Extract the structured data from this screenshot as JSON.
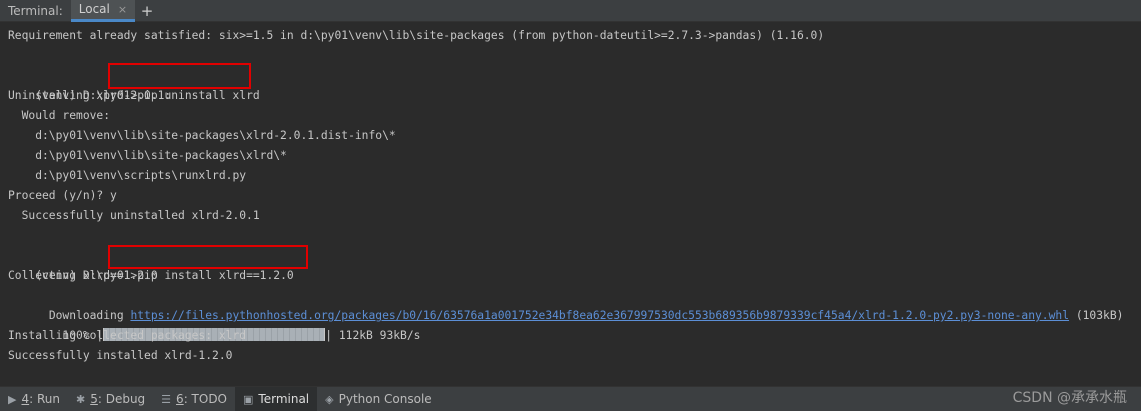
{
  "header": {
    "title": "Terminal:",
    "tab_label": "Local",
    "close_glyph": "×",
    "add_glyph": "+"
  },
  "terminal": {
    "line1": "Requirement already satisfied: six>=1.5 in d:\\py01\\venv\\lib\\site-packages (from python-dateutil>=2.7.3->pandas) (1.16.0)",
    "prompt": "(venv) D:\\py01>",
    "cmd1": "pip uninstall xlrd",
    "uninstalling": "Uninstalling xlrd-2.0.1:",
    "would_remove": "  Would remove:",
    "path1": "    d:\\py01\\venv\\lib\\site-packages\\xlrd-2.0.1.dist-info\\*",
    "path2": "    d:\\py01\\venv\\lib\\site-packages\\xlrd\\*",
    "path3": "    d:\\py01\\venv\\scripts\\runxlrd.py",
    "proceed": "Proceed (y/n)? y",
    "uninstalled": "  Successfully uninstalled xlrd-2.0.1",
    "cmd2": "pip install xlrd==1.2.0",
    "collecting": "Collecting xlrd==1.2.0",
    "downloading_label": "  Downloading ",
    "download_url": "https://files.pythonhosted.org/packages/b0/16/63576a1a001752e34bf8ea62e367997530dc553b689356b9879339cf45a4/xlrd-1.2.0-py2.py3-none-any.whl",
    "download_size": " (103kB)",
    "progress_percent_label": "    100% |",
    "progress_fraction": 1.0,
    "progress_tail": "| 112kB 93kB/s",
    "installing": "Installing collected packages: xlrd",
    "installed": "Successfully installed xlrd-1.2.0"
  },
  "bottombar": {
    "run": {
      "key": "4",
      "label": ": Run"
    },
    "debug": {
      "key": "5",
      "label": ": Debug"
    },
    "todo": {
      "key": "6",
      "label": ": TODO"
    },
    "terminal": {
      "label": "Terminal"
    },
    "python_console": {
      "label": "Python Console"
    }
  },
  "watermark": "CSDN @承承水瓶",
  "colors": {
    "background": "#2b2b2b",
    "highlight_box": "#e10000",
    "link": "#5c8fd6",
    "tab_accent": "#4a88c7"
  }
}
